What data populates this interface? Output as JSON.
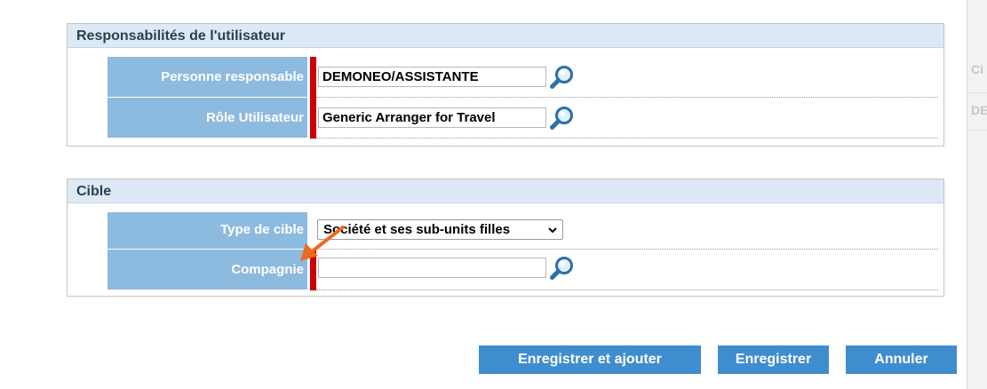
{
  "background": {
    "ghost_texts": [
      "Ci",
      "DE"
    ]
  },
  "responsibilities": {
    "title": "Responsabilités de l'utilisateur",
    "rows": [
      {
        "label": "Personne responsable",
        "value": "DEMONEO/ASSISTANTE",
        "lookup_icon": "magnifier-icon"
      },
      {
        "label": "Rôle Utilisateur",
        "value": "Generic Arranger for Travel",
        "lookup_icon": "magnifier-icon"
      }
    ]
  },
  "target": {
    "title": "Cible",
    "type_label": "Type de cible",
    "type_value": "Société et ses sub-units filles",
    "company_label": "Compagnie",
    "company_value": "",
    "lookup_icon": "magnifier-icon"
  },
  "buttons": {
    "save_add": "Enregistrer et ajouter",
    "save": "Enregistrer",
    "cancel": "Annuler"
  },
  "colors": {
    "label_bg": "#8dbadf",
    "required_marker": "#cc0000",
    "button_bg": "#3f8dcf",
    "header_bg": "#dde9f5",
    "annotation_arrow": "#f06a1d"
  }
}
